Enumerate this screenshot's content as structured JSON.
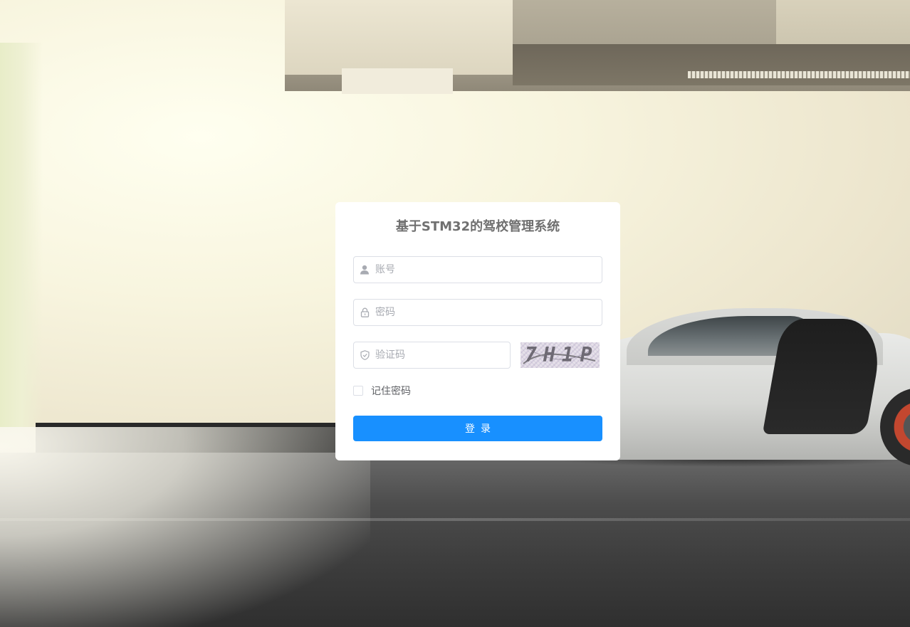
{
  "login": {
    "title": "基于STM32的驾校管理系统",
    "username": {
      "value": "",
      "placeholder": "账号",
      "icon": "user-icon"
    },
    "password": {
      "value": "",
      "placeholder": "密码",
      "icon": "lock-icon"
    },
    "captcha": {
      "value": "",
      "placeholder": "验证码",
      "icon": "shield-check-icon",
      "image_text": "7H1P"
    },
    "remember": {
      "label": "记住密码",
      "checked": false
    },
    "submit_label": "登录"
  },
  "colors": {
    "primary_button": "#1890ff",
    "input_border": "#dcdfe6",
    "placeholder": "#a8abb2",
    "title": "#707070"
  }
}
